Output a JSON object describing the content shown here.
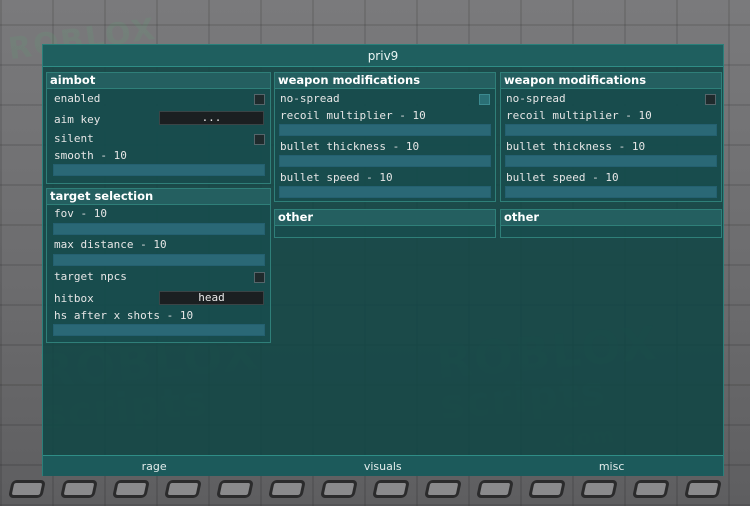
{
  "window": {
    "title": "priv9"
  },
  "watermark": {
    "line1": "ROBLOX",
    "line2": "scripts",
    "line3": ".com"
  },
  "aimbot": {
    "header": "aimbot",
    "enabled_label": "enabled",
    "aim_key_label": "aim key",
    "aim_key_value": "...",
    "silent_label": "silent",
    "smooth_label": "smooth - 10"
  },
  "target_selection": {
    "header": "target selection",
    "fov_label": "fov - 10",
    "max_distance_label": "max distance - 10",
    "target_npcs_label": "target npcs",
    "hitbox_label": "hitbox",
    "hitbox_value": "head",
    "hs_after_label": "hs after x shots - 10"
  },
  "weapon_mods_1": {
    "header": "weapon modifications",
    "no_spread_label": "no-spread",
    "no_spread_checked": true,
    "recoil_label": "recoil multiplier - 10",
    "bullet_thickness_label": "bullet thickness - 10",
    "bullet_speed_label": "bullet speed - 10"
  },
  "weapon_mods_2": {
    "header": "weapon modifications",
    "no_spread_label": "no-spread",
    "no_spread_checked": false,
    "recoil_label": "recoil multiplier - 10",
    "bullet_thickness_label": "bullet thickness - 10",
    "bullet_speed_label": "bullet speed - 10"
  },
  "other_1": {
    "header": "other"
  },
  "other_2": {
    "header": "other"
  },
  "tabs": [
    {
      "label": "rage"
    },
    {
      "label": "visuals"
    },
    {
      "label": "misc"
    }
  ]
}
